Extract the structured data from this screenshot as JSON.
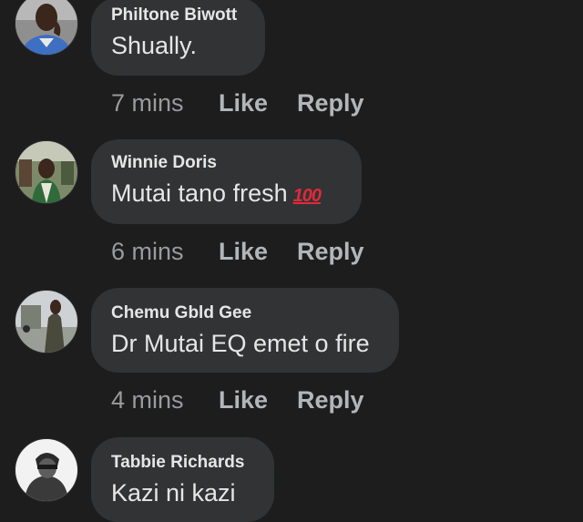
{
  "comments": [
    {
      "author": "Philtone Biwott",
      "text": "Shually.",
      "emoji": "",
      "time": "7 mins",
      "like_label": "Like",
      "reply_label": "Reply"
    },
    {
      "author": "Winnie Doris",
      "text": "Mutai tano fresh",
      "emoji": "100",
      "time": "6 mins",
      "like_label": "Like",
      "reply_label": "Reply"
    },
    {
      "author": "Chemu Gbld Gee",
      "text": "Dr Mutai EQ emet o fire",
      "emoji": "",
      "time": "4 mins",
      "like_label": "Like",
      "reply_label": "Reply"
    },
    {
      "author": "Tabbie Richards",
      "text": "Kazi ni kazi",
      "emoji": "",
      "time": "",
      "like_label": "",
      "reply_label": ""
    }
  ],
  "colors": {
    "background": "#1d1d1d",
    "bubble": "#323334",
    "text": "#e6e6e6",
    "meta": "#9a9b9d",
    "action": "#b4b5b7",
    "emoji_100": "#e02a3c"
  },
  "icons": {
    "emoji_100": "hundred-points-emoji"
  }
}
